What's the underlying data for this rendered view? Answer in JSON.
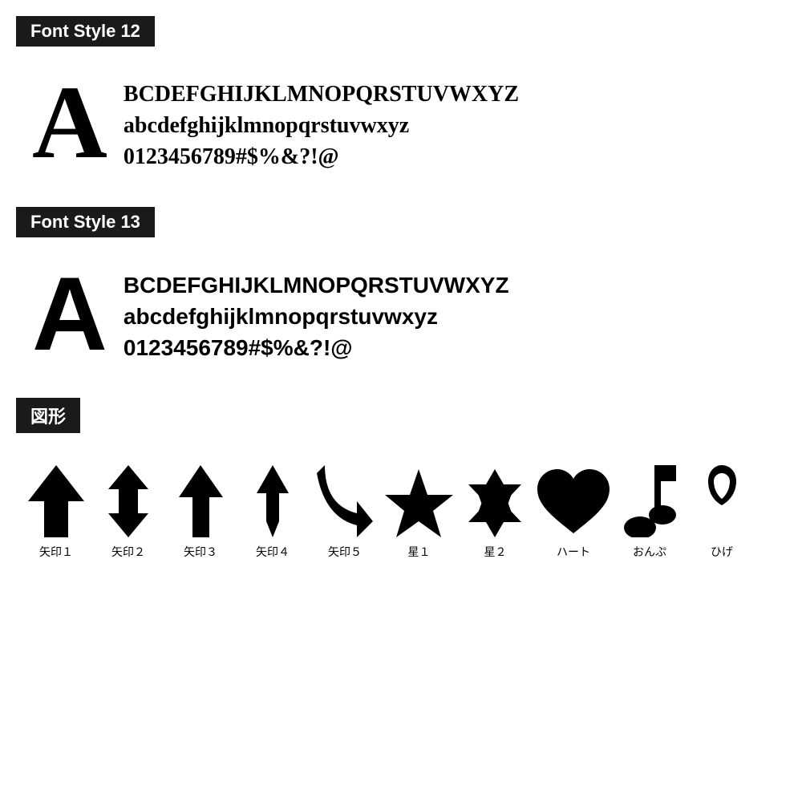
{
  "font12": {
    "header": "Font Style 12",
    "big_letter": "A",
    "line1": "BCDEFGHIJKLMNOPQRSTUVWXYZ",
    "line2": "abcdefghijklmnopqrstuvwxyz",
    "line3": "0123456789#$%&?!@"
  },
  "font13": {
    "header": "Font Style 13",
    "big_letter": "A",
    "line1": "BCDEFGHIJKLMNOPQRSTUVWXYZ",
    "line2": "abcdefghijklmnopqrstuvwxyz",
    "line3": "0123456789#$%&?!@"
  },
  "shapes": {
    "header": "図形",
    "items": [
      {
        "label": "矢印１",
        "name": "arrow1"
      },
      {
        "label": "矢印２",
        "name": "arrow2"
      },
      {
        "label": "矢印３",
        "name": "arrow3"
      },
      {
        "label": "矢印４",
        "name": "arrow4"
      },
      {
        "label": "矢印５",
        "name": "arrow5"
      },
      {
        "label": "星１",
        "name": "star1"
      },
      {
        "label": "星２",
        "name": "star2"
      },
      {
        "label": "ハート",
        "name": "heart"
      },
      {
        "label": "おんぷ",
        "name": "music"
      },
      {
        "label": "ひげ",
        "name": "mustache"
      }
    ]
  }
}
